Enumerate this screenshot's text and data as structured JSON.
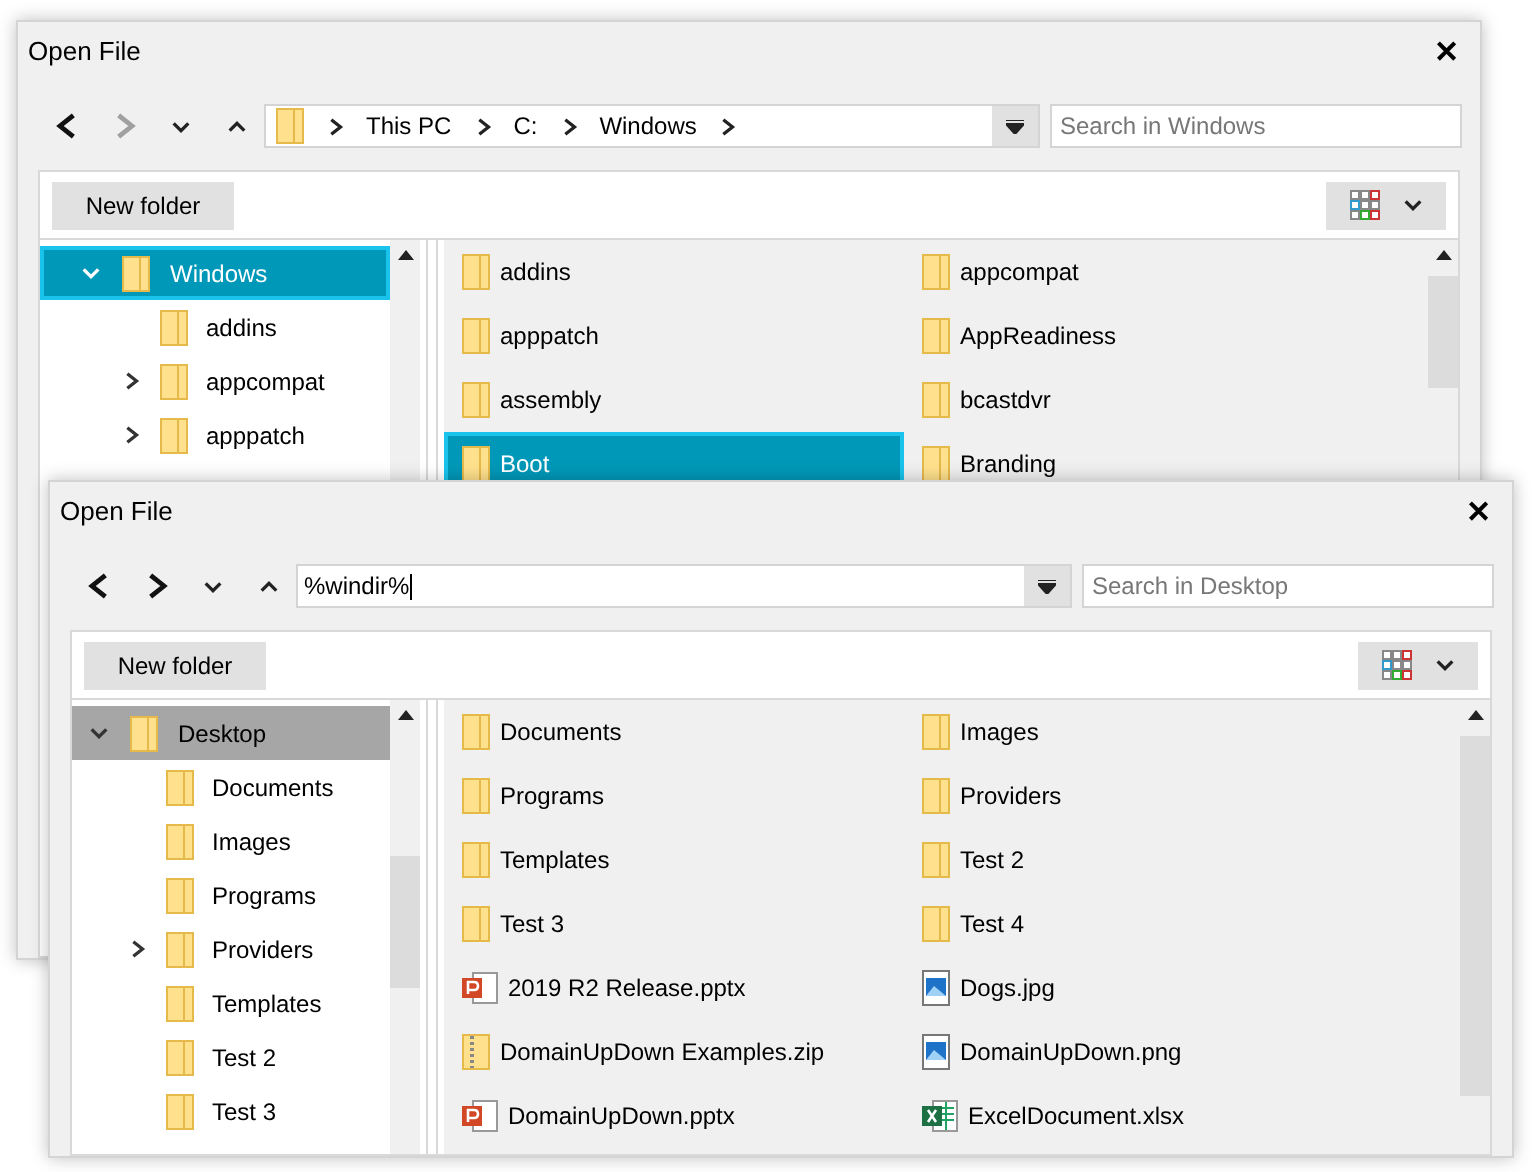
{
  "dialogs": [
    {
      "title": "Open File",
      "close": "✕",
      "nav_buttons": [
        {
          "kind": "back",
          "disabled": false
        },
        {
          "kind": "forward",
          "disabled": true
        },
        {
          "kind": "down",
          "disabled": false
        },
        {
          "kind": "up",
          "disabled": false
        }
      ],
      "address": {
        "kind": "breadcrumb",
        "segments": [
          "This PC",
          "C:",
          "Windows"
        ]
      },
      "search": {
        "placeholder": "Search in Windows"
      },
      "new_folder": "New folder",
      "tree": {
        "focused": true,
        "items": [
          {
            "label": "Windows",
            "selected": true,
            "expanded": true,
            "children": [
              {
                "label": "addins",
                "selected": false,
                "expandable": false
              },
              {
                "label": "appcompat",
                "selected": false,
                "expandable": true
              },
              {
                "label": "apppatch",
                "selected": false,
                "expandable": true
              }
            ]
          }
        ]
      },
      "files": [
        {
          "name": "addins",
          "kind": "folder",
          "selected": false
        },
        {
          "name": "appcompat",
          "kind": "folder",
          "selected": false
        },
        {
          "name": "apppatch",
          "kind": "folder",
          "selected": false
        },
        {
          "name": "AppReadiness",
          "kind": "folder",
          "selected": false
        },
        {
          "name": "assembly",
          "kind": "folder",
          "selected": false
        },
        {
          "name": "bcastdvr",
          "kind": "folder",
          "selected": false
        },
        {
          "name": "Boot",
          "kind": "folder",
          "selected": true
        },
        {
          "name": "Branding",
          "kind": "folder",
          "selected": false
        }
      ]
    },
    {
      "title": "Open File",
      "close": "✕",
      "nav_buttons": [
        {
          "kind": "back",
          "disabled": false
        },
        {
          "kind": "forward",
          "disabled": false
        },
        {
          "kind": "down",
          "disabled": false
        },
        {
          "kind": "up",
          "disabled": false
        }
      ],
      "address": {
        "kind": "text",
        "value": "%windir%"
      },
      "search": {
        "placeholder": "Search in Desktop"
      },
      "new_folder": "New folder",
      "tree": {
        "focused": false,
        "items": [
          {
            "label": "Desktop",
            "selected": true,
            "expanded": true,
            "children": [
              {
                "label": "Documents",
                "selected": false,
                "expandable": false
              },
              {
                "label": "Images",
                "selected": false,
                "expandable": false
              },
              {
                "label": "Programs",
                "selected": false,
                "expandable": false
              },
              {
                "label": "Providers",
                "selected": false,
                "expandable": true
              },
              {
                "label": "Templates",
                "selected": false,
                "expandable": false
              },
              {
                "label": "Test 2",
                "selected": false,
                "expandable": false
              },
              {
                "label": "Test 3",
                "selected": false,
                "expandable": false
              }
            ]
          }
        ]
      },
      "files": [
        {
          "name": "Documents",
          "kind": "folder",
          "selected": false
        },
        {
          "name": "Images",
          "kind": "folder",
          "selected": false
        },
        {
          "name": "Programs",
          "kind": "folder",
          "selected": false
        },
        {
          "name": "Providers",
          "kind": "folder",
          "selected": false
        },
        {
          "name": "Templates",
          "kind": "folder",
          "selected": false
        },
        {
          "name": "Test 2",
          "kind": "folder",
          "selected": false
        },
        {
          "name": "Test 3",
          "kind": "folder",
          "selected": false
        },
        {
          "name": "Test 4",
          "kind": "folder",
          "selected": false
        },
        {
          "name": "2019 R2 Release.pptx",
          "kind": "pptx",
          "selected": false
        },
        {
          "name": "Dogs.jpg",
          "kind": "image",
          "selected": false
        },
        {
          "name": "DomainUpDown Examples.zip",
          "kind": "zip",
          "selected": false
        },
        {
          "name": "DomainUpDown.png",
          "kind": "image",
          "selected": false
        },
        {
          "name": "DomainUpDown.pptx",
          "kind": "pptx",
          "selected": false
        },
        {
          "name": "ExcelDocument.xlsx",
          "kind": "xlsx",
          "selected": false
        }
      ]
    }
  ]
}
